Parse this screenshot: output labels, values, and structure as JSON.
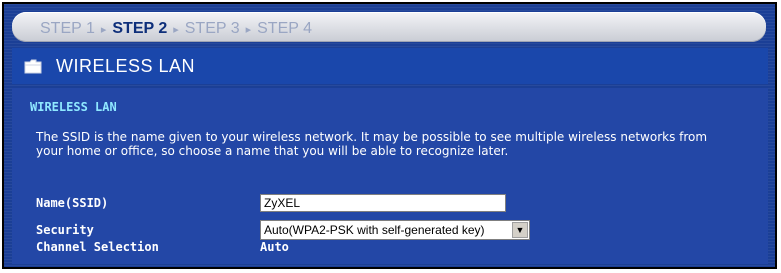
{
  "steps": [
    "STEP 1",
    "STEP 2",
    "STEP 3",
    "STEP 4"
  ],
  "active_step_index": 1,
  "header": {
    "title": "WIRELESS LAN",
    "icon": "folder-icon"
  },
  "section": {
    "title": "WIRELESS LAN"
  },
  "description": "The SSID is the name given to your wireless network. It may be possible to see multiple wireless networks from your home or office, so choose a name that you will be able to recognize later.",
  "fields": {
    "ssid_label": "Name(SSID)",
    "ssid_value": "ZyXEL",
    "security_label": "Security",
    "security_value": "Auto(WPA2-PSK with self-generated key)",
    "channel_label": "Channel Selection",
    "channel_value": "Auto"
  },
  "colors": {
    "background": "#1b3f96",
    "section_title": "#8fe8ff",
    "active_step": "#0e2f7a",
    "inactive_step": "#9aa6c3"
  }
}
